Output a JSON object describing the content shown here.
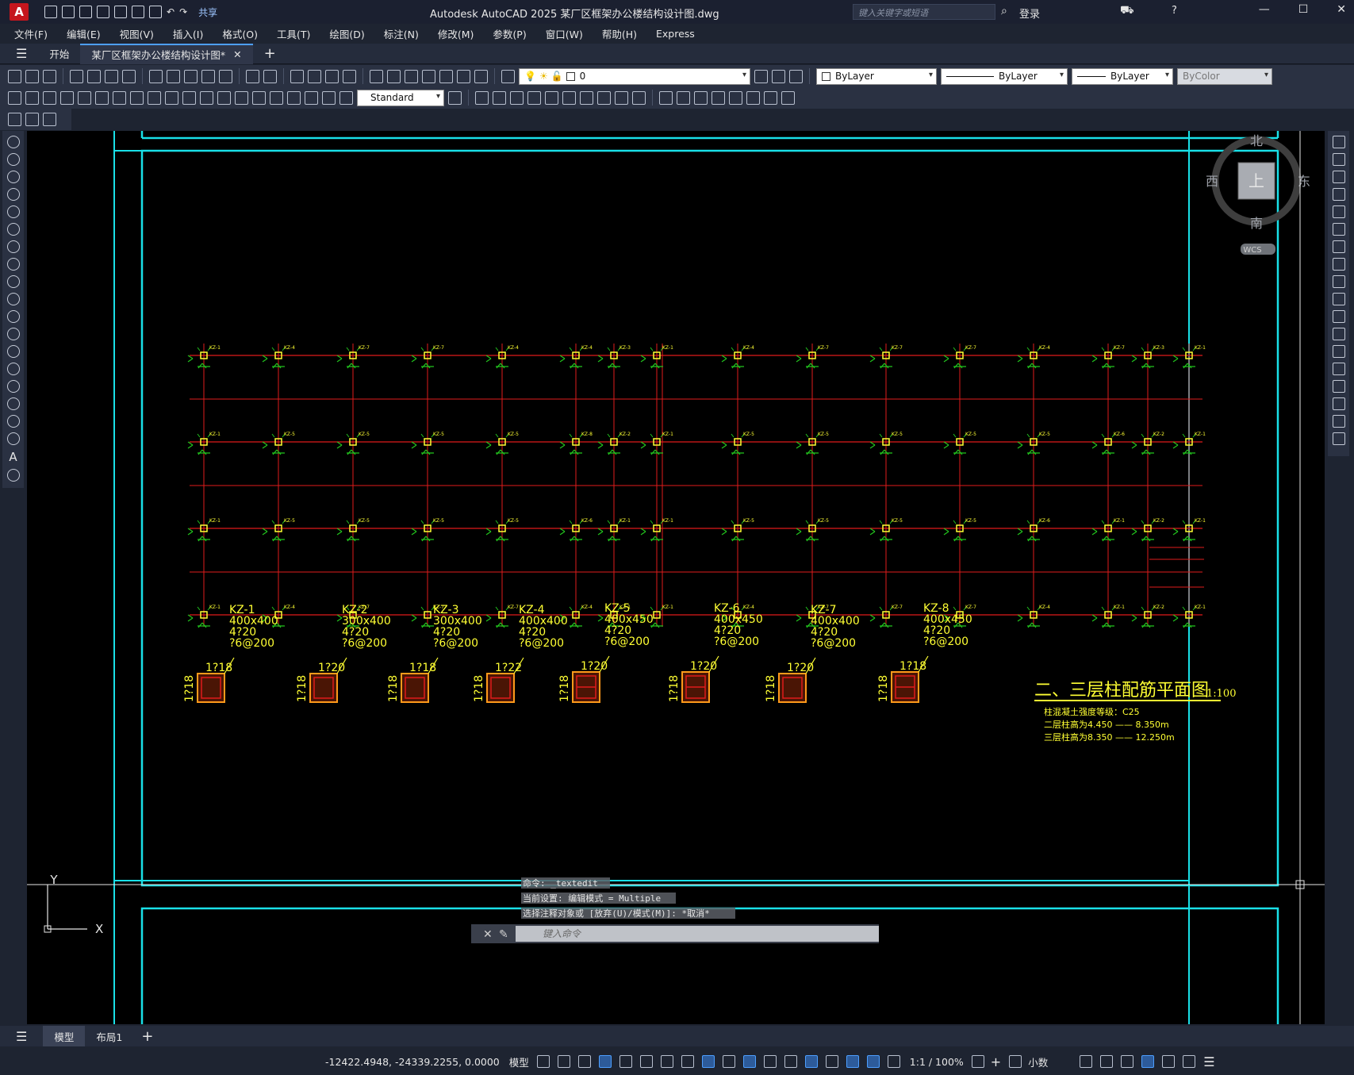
{
  "app": {
    "logo": "A",
    "share": "共享",
    "title": "Autodesk AutoCAD 2025    某厂区框架办公楼结构设计图.dwg",
    "search_placeholder": "键入关键字或短语",
    "login": "登录",
    "help": "?"
  },
  "menu": [
    "文件(F)",
    "编辑(E)",
    "视图(V)",
    "插入(I)",
    "格式(O)",
    "工具(T)",
    "绘图(D)",
    "标注(N)",
    "修改(M)",
    "参数(P)",
    "窗口(W)",
    "帮助(H)",
    "Express"
  ],
  "tabs": {
    "start": "开始",
    "file": "某厂区框架办公楼结构设计图*"
  },
  "toolbar": {
    "layer_value": "0",
    "color": "ByLayer",
    "linetype": "ByLayer",
    "lineweight": "ByLayer",
    "plotstyle": "ByColor",
    "textstyle": "Standard"
  },
  "viewcube": {
    "north": "北",
    "south": "南",
    "east": "东",
    "west": "西",
    "top": "上",
    "wcs": "WCS"
  },
  "ucs": {
    "x": "X",
    "y": "Y"
  },
  "drawing": {
    "title": "二、三层柱配筋平面图",
    "scale": "1:100",
    "notes": [
      "柱混凝土强度等级：C25",
      "二层柱高为4.450 —— 8.350m",
      "三层柱高为8.350 —— 12.250m"
    ],
    "column_tags_row1": [
      "KZ-1",
      "KZ-4",
      "KZ-7",
      "KZ-7",
      "KZ-4",
      "KZ-4",
      "KZ-3",
      "KZ-1",
      "KZ-4",
      "KZ-7",
      "KZ-7",
      "KZ-7",
      "KZ-4",
      "KZ-7",
      "KZ-3",
      "KZ-1"
    ],
    "column_tags_row2": [
      "KZ-1",
      "KZ-5",
      "KZ-5",
      "KZ-5",
      "KZ-5",
      "KZ-8",
      "KZ-2",
      "KZ-1",
      "KZ-5",
      "KZ-5",
      "KZ-5",
      "KZ-5",
      "KZ-5",
      "KZ-6",
      "KZ-2",
      "KZ-1"
    ],
    "column_tags_row3": [
      "KZ-1",
      "KZ-5",
      "KZ-5",
      "KZ-5",
      "KZ-5",
      "KZ-6",
      "KZ-1",
      "KZ-1",
      "KZ-5",
      "KZ-5",
      "KZ-5",
      "KZ-5",
      "KZ-6",
      "KZ-1",
      "KZ-2",
      "KZ-1"
    ],
    "column_tags_row4": [
      "KZ-1",
      "KZ-4",
      "KZ-7",
      "KZ-7",
      "KZ-7",
      "KZ-4",
      "KZ-1",
      "KZ-1",
      "KZ-4",
      "KZ-7",
      "KZ-7",
      "KZ-7",
      "KZ-4",
      "KZ-1",
      "KZ-2",
      "KZ-1"
    ],
    "details": [
      {
        "name": "KZ-1",
        "size": "400x400",
        "main": "4?20",
        "stirrup": "?6@200",
        "side_top": "1?18",
        "side_left": "1?18"
      },
      {
        "name": "KZ-2",
        "size": "300x400",
        "main": "4?20",
        "stirrup": "?6@200",
        "side_top": "1?20",
        "side_left": "1?18"
      },
      {
        "name": "KZ-3",
        "size": "300x400",
        "main": "4?20",
        "stirrup": "?6@200",
        "side_top": "1?18",
        "side_left": "1?18"
      },
      {
        "name": "KZ-4",
        "size": "400x400",
        "main": "4?20",
        "stirrup": "?6@200",
        "side_top": "1?22",
        "side_left": "1?18"
      },
      {
        "name": "KZ-5",
        "size": "400x450",
        "main": "4?20",
        "stirrup": "?6@200",
        "side_top": "1?20",
        "side_left": "1?18"
      },
      {
        "name": "KZ-6",
        "size": "400x450",
        "main": "4?20",
        "stirrup": "?6@200",
        "side_top": "1?20",
        "side_left": "1?18"
      },
      {
        "name": "KZ-7",
        "size": "400x400",
        "main": "4?20",
        "stirrup": "?6@200",
        "side_top": "1?20",
        "side_left": "1?18"
      },
      {
        "name": "KZ-8",
        "size": "400x450",
        "main": "4?20",
        "stirrup": "?6@200",
        "side_top": "1?18",
        "side_left": "1?18"
      }
    ]
  },
  "command": {
    "history": [
      "命令: _textedit",
      "当前设置: 编辑模式 = Multiple",
      "选择注释对象或 [放弃(U)/模式(M)]: *取消*"
    ],
    "placeholder": "键入命令"
  },
  "layout_tabs": [
    "模型",
    "布局1"
  ],
  "status": {
    "coords": "-12422.4948, -24339.2255, 0.0000",
    "model": "模型",
    "scale": "1:1 / 100%",
    "units": "小数"
  },
  "colors": {
    "cyan": "#19e0e8",
    "red": "#e01b1b",
    "yellow": "#ffff33",
    "green": "#22c51e",
    "orange": "#ff9a1a"
  }
}
